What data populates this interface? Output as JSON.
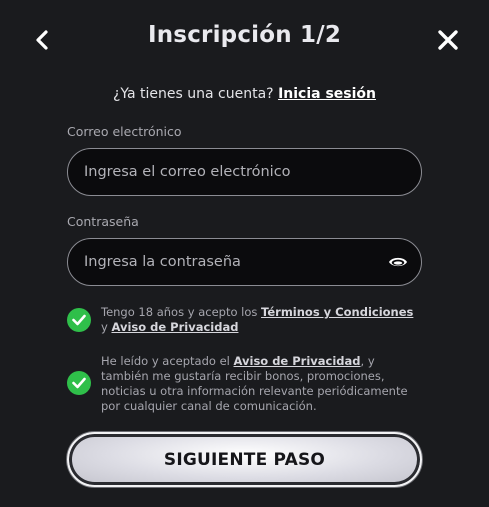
{
  "header": {
    "title": "Inscripción 1/2",
    "back_icon": "chevron-left-icon",
    "close_icon": "close-icon"
  },
  "login_prompt": {
    "text": "¿Ya tienes una cuenta?",
    "link": "Inicia sesión"
  },
  "form": {
    "email": {
      "label": "Correo electrónico",
      "placeholder": "Ingresa el correo electrónico",
      "value": ""
    },
    "password": {
      "label": "Contraseña",
      "placeholder": "Ingresa la contraseña",
      "value": "",
      "toggle_icon": "eye-icon"
    }
  },
  "consents": [
    {
      "checked": true,
      "text_before": "Tengo 18 años y acepto los",
      "link1": "Términos y Condiciones",
      "middle": "y",
      "link2": "Aviso de Privacidad"
    },
    {
      "checked": true,
      "text_before": "He leído y aceptado el",
      "link": "Aviso de Privacidad",
      "text_after": ", y también me gustaría recibir bonos, promociones, noticias u otra información relevante periódicamente por cualquier canal de comunicación."
    }
  ],
  "submit": {
    "label": "SIGUIENTE PASO"
  },
  "colors": {
    "background": "#1a1b1e",
    "check_green": "#2fbf4a",
    "input_bg": "#0b0b0d"
  }
}
